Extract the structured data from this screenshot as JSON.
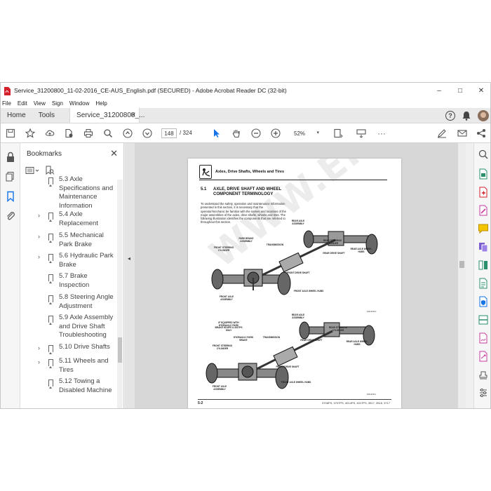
{
  "window": {
    "title": "Service_31200800_11-02-2016_CE-AUS_English.pdf (SECURED) - Adobe Acrobat Reader DC (32-bit)",
    "minimize": "–",
    "maximize": "□",
    "close": "✕"
  },
  "menu": [
    "File",
    "Edit",
    "View",
    "Sign",
    "Window",
    "Help"
  ],
  "tabs": {
    "home": "Home",
    "tools": "Tools",
    "doc": "Service_31200800_...",
    "doc_close": "✕",
    "help": "?"
  },
  "toolbar": {
    "page_current": "148",
    "page_total": "/  324",
    "zoom": "52%"
  },
  "bookmarks": {
    "title": "Bookmarks",
    "close": "✕",
    "items": [
      {
        "label": "5.3 Axle Specifications and Maintenance Information",
        "expandable": false
      },
      {
        "label": "5.4 Axle Replacement",
        "expandable": true
      },
      {
        "label": "5.5 Mechanical Park Brake",
        "expandable": true
      },
      {
        "label": "5.6 Hydraulic Park Brake",
        "expandable": true
      },
      {
        "label": "5.7 Brake Inspection",
        "expandable": false
      },
      {
        "label": "5.8 Steering Angle Adjustment",
        "expandable": false
      },
      {
        "label": "5.9 Axle Assembly and Drive Shaft Troubleshooting",
        "expandable": false
      },
      {
        "label": "5.10 Drive Shafts",
        "expandable": true
      },
      {
        "label": "5.11 Wheels and Tires",
        "expandable": true
      },
      {
        "label": "5.12 Towing a Disabled Machine",
        "expandable": false
      }
    ]
  },
  "page": {
    "chapter": "Axles, Drive Shafts, Wheels and Tires",
    "section_number": "5.1",
    "section_title": "AXLE, DRIVE SHAFT AND WHEEL COMPONENT TERMINOLOGY",
    "body": "To understand the safety, operation and maintenance information presented in this section, it is necessary that the operator/mechanic be familiar with the names and locations of the major assemblies of the axles, drive shafts, wheels and tires. The following illustration identifies the components that are referred to throughout this section.",
    "footer_page": "5-2",
    "footer_models": "3706PS, 3707PS, 4014PS, 4017PS, 3517, 3518, 3717",
    "watermark": "WWW.EPCATALOG.COM",
    "figure1": {
      "labels": {
        "park_brake": "PARK BRAKE ASSEMBLY",
        "transmission": "TRANSMISSION",
        "front_steering": "FRONT STEERING CYLINDER",
        "rear_axle": "REAR AXLE ASSEMBLY",
        "rear_steering": "REAR STEERING CYLINDER",
        "rear_hub": "REAR AXLE WHEEL HUBS",
        "rear_drive": "REAR DRIVE SHAFT",
        "front_drive": "FRONT DRIVE SHAFT",
        "front_hub": "FRONT AXLE WHEEL HUBS",
        "front_axle": "FRONT AXLE ASSEMBLY"
      },
      "id": "MAH0310"
    },
    "figure2": {
      "labels": {
        "equipped": "IF EQUIPPED WITH HYDRAULIC PARK BRAKE 3014PS & 4017PS ONLY",
        "hydraulic": "HYDRAULIC PARK BRAKE",
        "transmission": "TRANSMISSION",
        "front_steering": "FRONT STEERING CYLINDER",
        "rear_axle": "REAR AXLE ASSEMBLY",
        "rear_steering": "REAR STEERING CYLINDER",
        "rear_drive": "REAR DRIVE SHAFT",
        "rear_hub": "REAR AXLE WHEEL HUBS",
        "front_drive": "FRONT DRIVE SHAFT",
        "front_hub": "FRONT AXLE WHEEL HUBS",
        "front_axle": "FRONT AXLE ASSEMBLY"
      },
      "id": "MAH0311"
    }
  },
  "colors": {
    "acrobat_red": "#d4202b",
    "accent_blue": "#1473e6"
  }
}
